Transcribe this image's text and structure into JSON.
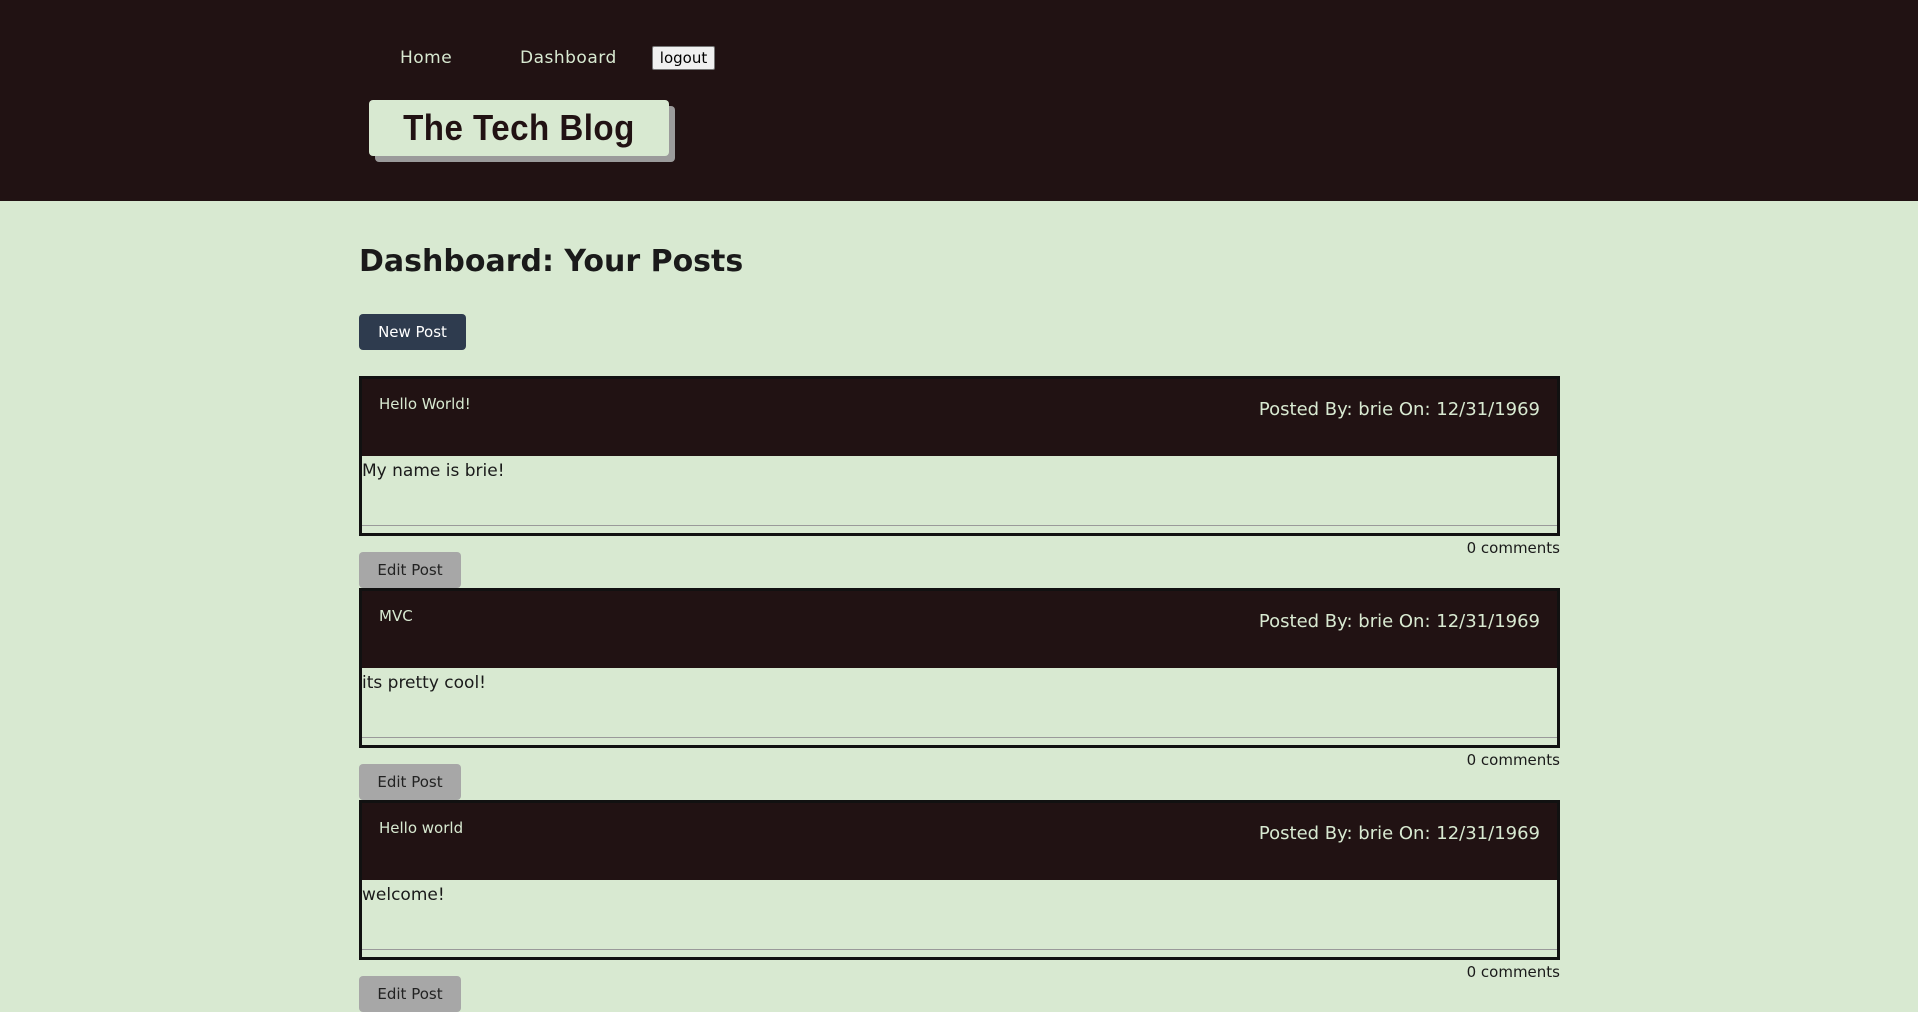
{
  "nav": {
    "home_label": "Home",
    "dashboard_label": "Dashboard",
    "logout_label": "logout"
  },
  "logo": {
    "text": "The Tech Blog"
  },
  "dashboard": {
    "title": "Dashboard: Your Posts",
    "new_post_label": "New Post"
  },
  "posts": [
    {
      "title": "Hello World!",
      "meta": "Posted By: brie On: 12/31/1969",
      "body": "My name is brie!",
      "comments": "0 comments",
      "edit_label": "Edit Post"
    },
    {
      "title": "MVC",
      "meta": "Posted By: brie On: 12/31/1969",
      "body": "its pretty cool!",
      "comments": "0 comments",
      "edit_label": "Edit Post"
    },
    {
      "title": "Hello world",
      "meta": "Posted By: brie On: 12/31/1969",
      "body": "welcome!",
      "comments": "0 comments",
      "edit_label": "Edit Post"
    }
  ],
  "colors": {
    "header_bg": "#211213",
    "page_bg": "#d8e9d1",
    "primary_button": "#2e3b4e",
    "secondary_button": "#a7a7a7"
  }
}
